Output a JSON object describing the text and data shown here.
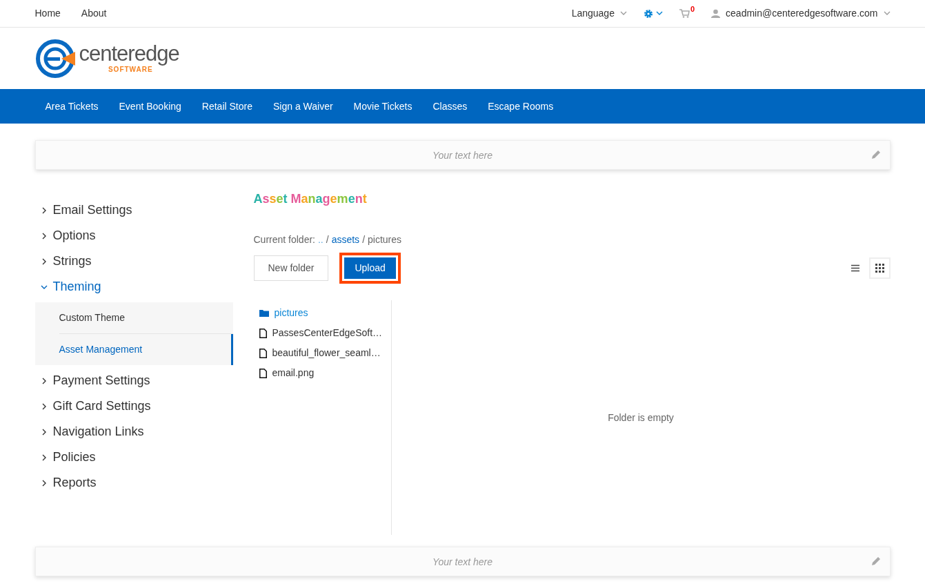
{
  "top_nav": {
    "links": [
      "Home",
      "About"
    ],
    "language": "Language",
    "cart_count": "0",
    "user": "ceadmin@centeredgesoftware.com"
  },
  "logo": {
    "name": "centeredge",
    "tagline": "SOFTWARE"
  },
  "main_nav": [
    "Area Tickets",
    "Event Booking",
    "Retail Store",
    "Sign a Waiver",
    "Movie Tickets",
    "Classes",
    "Escape Rooms"
  ],
  "top_banner": {
    "placeholder": "Your text here"
  },
  "sidebar": [
    {
      "label": "Email Settings",
      "expanded": false
    },
    {
      "label": "Options",
      "expanded": false
    },
    {
      "label": "Strings",
      "expanded": false
    },
    {
      "label": "Theming",
      "expanded": true,
      "children": [
        {
          "label": "Custom Theme",
          "selected": false
        },
        {
          "label": "Asset Management",
          "selected": true
        }
      ]
    },
    {
      "label": "Payment Settings",
      "expanded": false
    },
    {
      "label": "Gift Card Settings",
      "expanded": false
    },
    {
      "label": "Navigation Links",
      "expanded": false
    },
    {
      "label": "Policies",
      "expanded": false
    },
    {
      "label": "Reports",
      "expanded": false
    }
  ],
  "page_title": "Asset Management",
  "breadcrumb": {
    "label": "Current folder:",
    "parts": [
      {
        "text": "..",
        "link": true
      },
      {
        "separator": "/",
        "text": "assets",
        "link": true
      },
      {
        "separator": "/",
        "text": "pictures",
        "link": false
      }
    ]
  },
  "buttons": {
    "new_folder": "New folder",
    "upload": "Upload"
  },
  "view_modes": [
    {
      "kind": "list",
      "selected": false
    },
    {
      "kind": "grid",
      "selected": true
    }
  ],
  "files": [
    {
      "kind": "folder",
      "name": "pictures",
      "selected": true
    },
    {
      "kind": "file",
      "name": "PassesCenterEdgeSoft…",
      "selected": false
    },
    {
      "kind": "file",
      "name": "beautiful_flower_seaml…",
      "selected": false
    },
    {
      "kind": "file",
      "name": "email.png",
      "selected": false
    }
  ],
  "preview": {
    "empty_text": "Folder is empty"
  },
  "bottom_banner": {
    "placeholder": "Your text here"
  }
}
